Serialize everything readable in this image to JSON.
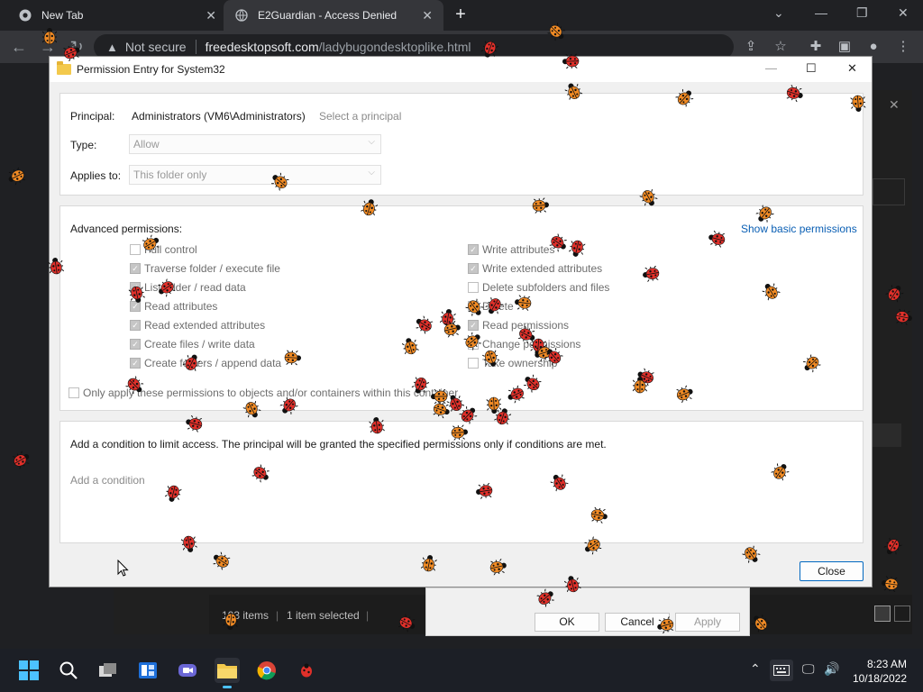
{
  "browser": {
    "tabs": [
      {
        "title": "New Tab"
      },
      {
        "title": "E2Guardian - Access Denied"
      }
    ],
    "address": {
      "security_label": "Not secure",
      "host": "freedesktopsoft.com",
      "path": "/ladybugondesktoplike.html"
    }
  },
  "dialog": {
    "title": "Permission Entry for System32",
    "principal_label": "Principal:",
    "principal_value": "Administrators (VM6\\Administrators)",
    "select_principal_link": "Select a principal",
    "type_label": "Type:",
    "type_value": "Allow",
    "applies_label": "Applies to:",
    "applies_value": "This folder only",
    "advanced_label": "Advanced permissions:",
    "show_basic_link": "Show basic permissions",
    "permissions_left": [
      {
        "label": "Full control",
        "checked": false
      },
      {
        "label": "Traverse folder / execute file",
        "checked": true
      },
      {
        "label": "List folder / read data",
        "checked": true
      },
      {
        "label": "Read attributes",
        "checked": true
      },
      {
        "label": "Read extended attributes",
        "checked": true
      },
      {
        "label": "Create files / write data",
        "checked": true
      },
      {
        "label": "Create folders / append data",
        "checked": true
      }
    ],
    "permissions_right": [
      {
        "label": "Write attributes",
        "checked": true
      },
      {
        "label": "Write extended attributes",
        "checked": true
      },
      {
        "label": "Delete subfolders and files",
        "checked": false
      },
      {
        "label": "Delete",
        "checked": false
      },
      {
        "label": "Read permissions",
        "checked": true
      },
      {
        "label": "Change permissions",
        "checked": false
      },
      {
        "label": "Take ownership",
        "checked": false
      }
    ],
    "only_apply_label": "Only apply these permissions to objects and/or containers within this container",
    "condition_text": "Add a condition to limit access. The principal will be granted the specified permissions only if conditions are met.",
    "add_condition_link": "Add a condition",
    "close_button": "Close"
  },
  "background_dialog": {
    "ok": "OK",
    "cancel": "Cancel",
    "apply": "Apply"
  },
  "explorer_status": {
    "items": "103 items",
    "selected": "1 item selected"
  },
  "taskbar": {
    "time": "8:23 AM",
    "date": "10/18/2022"
  },
  "colors": {
    "link": "#0a5fb4",
    "ladybug_red": "#e0302a",
    "ladybug_orange": "#f08a24",
    "taskbar_accent": "#4cc2ff"
  }
}
